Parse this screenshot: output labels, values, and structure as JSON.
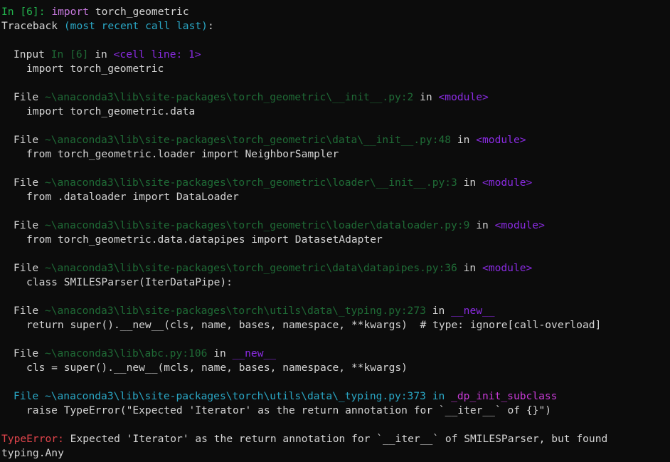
{
  "prompt": {
    "label": "In [6]:",
    "keyword": "import",
    "module": "torch_geometric"
  },
  "traceback_header": {
    "word": "Traceback",
    "paren": "(most recent call last)",
    "colon": ":"
  },
  "frames": [
    {
      "kind": "input",
      "label": "Input",
      "location": "In [6]",
      "in": "in",
      "where": "<cell line: 1>",
      "code": "import torch_geometric"
    },
    {
      "kind": "file",
      "label": "File",
      "location": "~\\anaconda3\\lib\\site-packages\\torch_geometric\\__init__.py:2",
      "in": "in",
      "where": "<module>",
      "code": "import torch_geometric.data"
    },
    {
      "kind": "file",
      "label": "File",
      "location": "~\\anaconda3\\lib\\site-packages\\torch_geometric\\data\\__init__.py:48",
      "in": "in",
      "where": "<module>",
      "code": "from torch_geometric.loader import NeighborSampler"
    },
    {
      "kind": "file",
      "label": "File",
      "location": "~\\anaconda3\\lib\\site-packages\\torch_geometric\\loader\\__init__.py:3",
      "in": "in",
      "where": "<module>",
      "code": "from .dataloader import DataLoader"
    },
    {
      "kind": "file",
      "label": "File",
      "location": "~\\anaconda3\\lib\\site-packages\\torch_geometric\\loader\\dataloader.py:9",
      "in": "in",
      "where": "<module>",
      "code": "from torch_geometric.data.datapipes import DatasetAdapter"
    },
    {
      "kind": "file",
      "label": "File",
      "location": "~\\anaconda3\\lib\\site-packages\\torch_geometric\\data\\datapipes.py:36",
      "in": "in",
      "where": "<module>",
      "code": "class SMILESParser(IterDataPipe):"
    },
    {
      "kind": "file",
      "label": "File",
      "location": "~\\anaconda3\\lib\\site-packages\\torch\\utils\\data\\_typing.py:273",
      "in": "in",
      "where": "__new__",
      "code": "return super().__new__(cls, name, bases, namespace, **kwargs)  # type: ignore[call-overload]"
    },
    {
      "kind": "file",
      "label": "File",
      "location": "~\\anaconda3\\lib\\abc.py:106",
      "in": "in",
      "where": "__new__",
      "code": "cls = super().__new__(mcls, name, bases, namespace, **kwargs)"
    },
    {
      "kind": "last",
      "label": "File",
      "location": "~\\anaconda3\\lib\\site-packages\\torch\\utils\\data\\_typing.py:373",
      "in": "in",
      "where": "_dp_init_subclass",
      "code": "raise TypeError(\"Expected 'Iterator' as the return annotation for `__iter__` of {}\")"
    }
  ],
  "error": {
    "type": "TypeError:",
    "message": "Expected 'Iterator' as the return annotation for `__iter__` of SMILESParser, but found",
    "message_cont": "typing.Any"
  },
  "colors": {
    "background": "#0c0c0c",
    "text": "#d4d4d4",
    "prompt_green": "#22b24c",
    "keyword": "#c678dd",
    "cyan": "#2aa7c5",
    "dim_path": "#1f6b36",
    "module_purple": "#8a2be2",
    "function_magenta": "#c93bd8",
    "error_red": "#e0444b"
  }
}
